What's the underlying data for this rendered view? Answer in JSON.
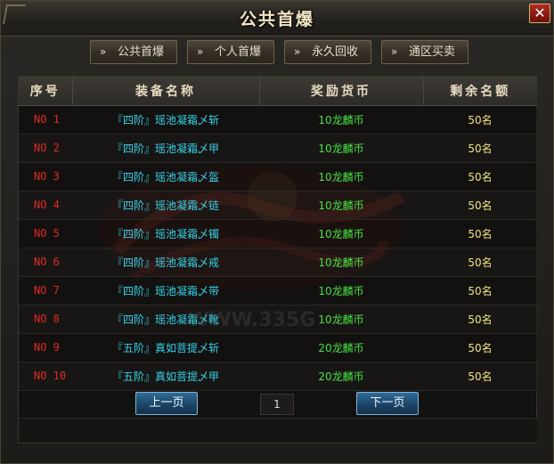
{
  "window": {
    "title": "公共首爆",
    "close_label": "✕"
  },
  "tabs": [
    {
      "chevron": "»",
      "label": "公共首爆"
    },
    {
      "chevron": "»",
      "label": "个人首爆"
    },
    {
      "chevron": "»",
      "label": "永久回收"
    },
    {
      "chevron": "»",
      "label": "通区买卖"
    }
  ],
  "table": {
    "headers": [
      "序号",
      "装备名称",
      "奖励货币",
      "剩余名额"
    ],
    "rows": [
      {
        "no": "NO 1",
        "name": "『四阶』瑶池凝霜乄斩",
        "reward": "10龙麟币",
        "left": "50名"
      },
      {
        "no": "NO 2",
        "name": "『四阶』瑶池凝霜乄甲",
        "reward": "10龙麟币",
        "left": "50名"
      },
      {
        "no": "NO 3",
        "name": "『四阶』瑶池凝霜乄盔",
        "reward": "10龙麟币",
        "left": "50名"
      },
      {
        "no": "NO 4",
        "name": "『四阶』瑶池凝霜乄链",
        "reward": "10龙麟币",
        "left": "50名"
      },
      {
        "no": "NO 5",
        "name": "『四阶』瑶池凝霜乄镯",
        "reward": "10龙麟币",
        "left": "50名"
      },
      {
        "no": "NO 6",
        "name": "『四阶』瑶池凝霜乄戒",
        "reward": "10龙麟币",
        "left": "50名"
      },
      {
        "no": "NO 7",
        "name": "『四阶』瑶池凝霜乄带",
        "reward": "10龙麟币",
        "left": "50名"
      },
      {
        "no": "NO 8",
        "name": "『四阶』瑶池凝霜乄靴",
        "reward": "10龙麟币",
        "left": "50名"
      },
      {
        "no": "NO 9",
        "name": "『五阶』真如菩提乄斩",
        "reward": "20龙麟币",
        "left": "50名"
      },
      {
        "no": "NO 10",
        "name": "『五阶』真如菩提乄甲",
        "reward": "20龙麟币",
        "left": "50名"
      }
    ]
  },
  "pager": {
    "prev_label": "上一页",
    "page": "1",
    "next_label": "下一页"
  },
  "watermark": {
    "site": "WWW.335G"
  },
  "colors": {
    "no": "#e02a1f",
    "name": "#33d2e8",
    "reward": "#45e03e",
    "left": "#f2e47a",
    "title": "#f2e7c4",
    "pager_button": "#1b4567"
  }
}
